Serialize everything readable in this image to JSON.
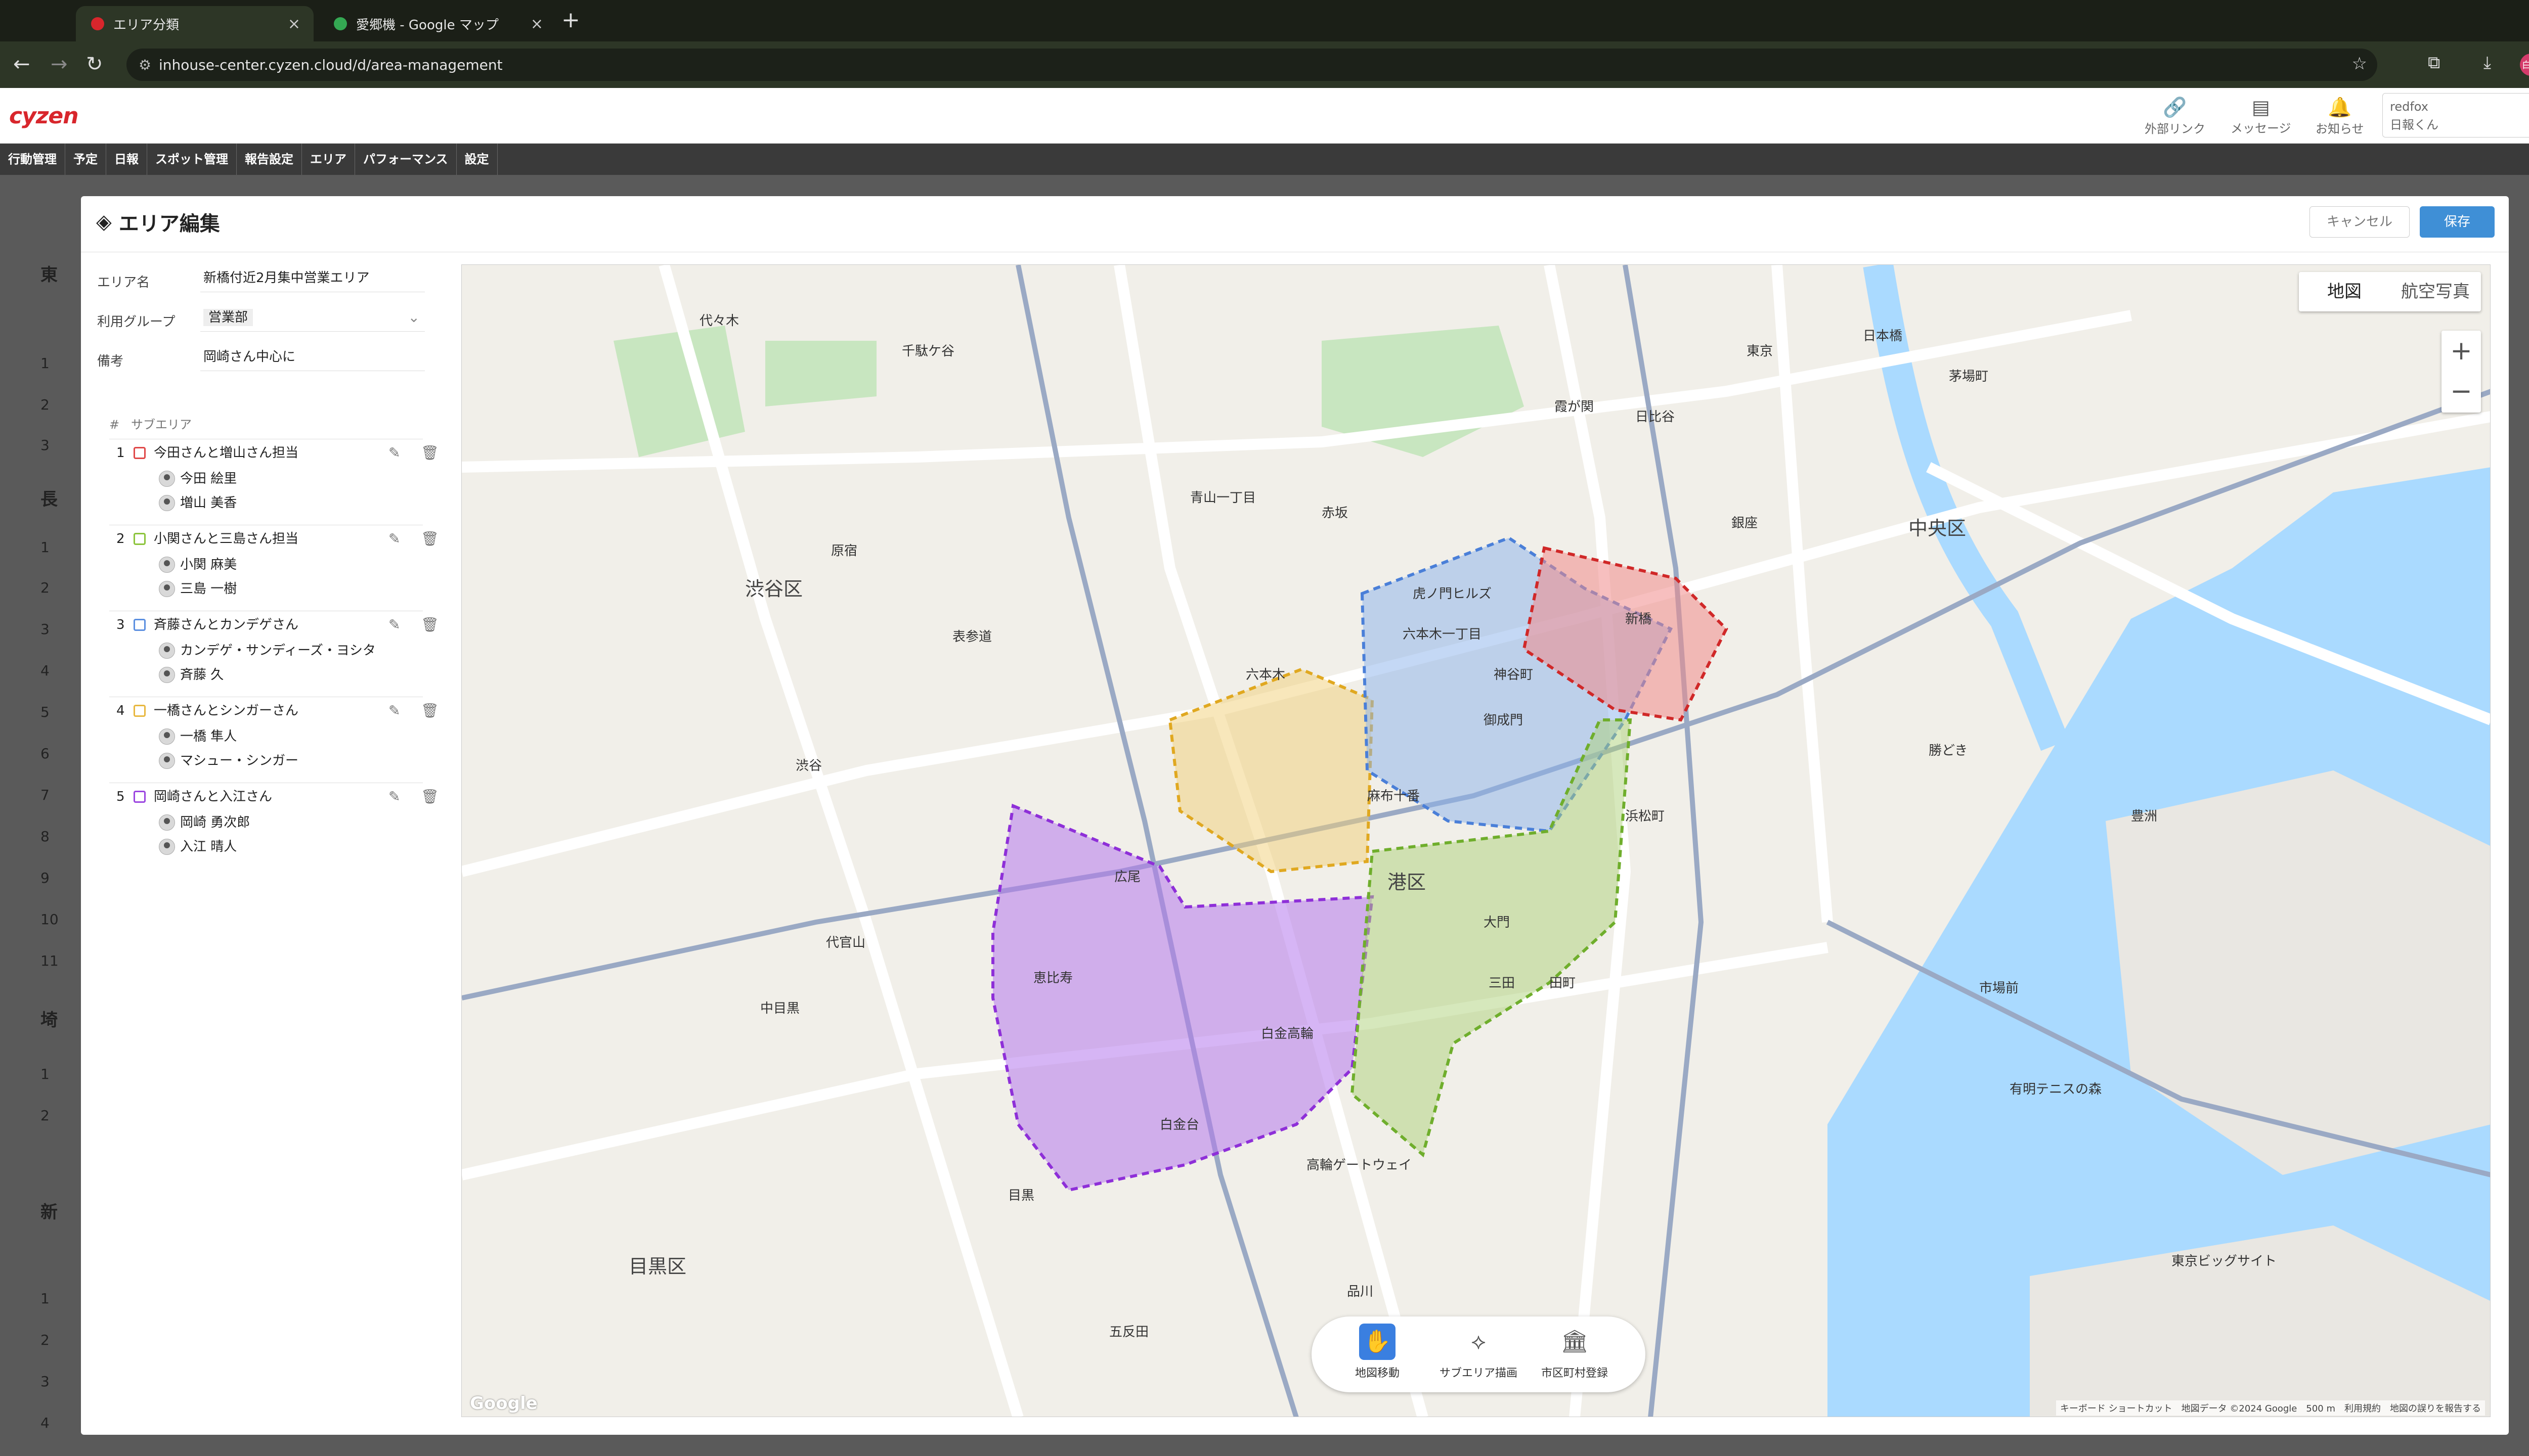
{
  "browser": {
    "tabs": [
      {
        "title": "エリア分類",
        "active": true
      },
      {
        "title": "愛郷機 - Google マップ",
        "active": false
      }
    ],
    "url": "inhouse-center.cyzen.cloud/d/area-management",
    "profile_initial": "白石"
  },
  "app": {
    "logo": "cyzen",
    "header_icons": [
      {
        "icon": "link-icon",
        "label": "外部リンク"
      },
      {
        "icon": "message-icon",
        "label": "メッセージ"
      },
      {
        "icon": "bell-icon",
        "label": "お知らせ"
      }
    ],
    "user": {
      "company": "redfox",
      "name": "日報くん"
    },
    "menu": [
      "行動管理",
      "予定",
      "日報",
      "スポット管理",
      "報告設定",
      "エリア",
      "パフォーマンス",
      "設定"
    ]
  },
  "background_page": {
    "sections": [
      "東",
      "長",
      "埼",
      "新"
    ],
    "row_numbers_1": [
      "1",
      "2",
      "3"
    ],
    "row_numbers_2": [
      "1",
      "2",
      "3",
      "4",
      "5",
      "6",
      "7",
      "8",
      "9",
      "10",
      "11"
    ],
    "row_numbers_3": [
      "1",
      "2"
    ],
    "row_numbers_4": [
      "1",
      "2",
      "3",
      "4"
    ]
  },
  "modal": {
    "title": "エリア編集",
    "cancel_label": "キャンセル",
    "save_label": "保存",
    "fields": {
      "area_name_label": "エリア名",
      "area_name_value": "新橋付近2月集中営業エリア",
      "group_label": "利用グループ",
      "group_value": "営業部",
      "note_label": "備考",
      "note_value": "岡崎さん中心に"
    },
    "subarea_header": {
      "num": "#",
      "label": "サブエリア"
    },
    "subareas": [
      {
        "num": "1",
        "name": "今田さんと増山さん担当",
        "color": "#e04848",
        "members": [
          "今田 絵里",
          "増山 美香"
        ]
      },
      {
        "num": "2",
        "name": "小関さんと三島さん担当",
        "color": "#8cc43c",
        "members": [
          "小関 麻美",
          "三島 一樹"
        ]
      },
      {
        "num": "3",
        "name": "斉藤さんとカンデゲさん",
        "color": "#5b8fe0",
        "members": [
          "カンデゲ・サンディーズ・ヨシタ",
          "斉藤 久"
        ]
      },
      {
        "num": "4",
        "name": "一橋さんとシンガーさん",
        "color": "#e8b840",
        "members": [
          "一橋 隼人",
          "マシュー・シンガー"
        ]
      },
      {
        "num": "5",
        "name": "岡崎さんと入江さん",
        "color": "#9b45e0",
        "members": [
          "岡崎 勇次郎",
          "入江 晴人"
        ]
      }
    ]
  },
  "map": {
    "type_map": "地図",
    "type_satellite": "航空写真",
    "zoom_in": "+",
    "zoom_out": "−",
    "tools": [
      {
        "icon": "hand-icon",
        "label": "地図移動",
        "active": true
      },
      {
        "icon": "polygon-draw-icon",
        "label": "サブエリア描画",
        "active": false
      },
      {
        "icon": "city-hall-icon",
        "label": "市区町村登録",
        "active": false
      }
    ],
    "attribution": "キーボード ショートカット　地図データ ©2024 Google　500 m　利用規約　地図の誤りを報告する",
    "google": "Google",
    "labels": {
      "shibuya": "渋谷区",
      "minato": "港区",
      "chuo": "中央区",
      "meguro": "目黒区",
      "toranomon": "虎ノ門ヒルズ",
      "roppongi1": "六本木一丁目",
      "shimbashi": "新橋",
      "kamiyacho": "神谷町",
      "onarimon": "御成門",
      "azabujuban": "麻布十番",
      "hiroo": "広尾",
      "ebisu": "恵比寿",
      "shirokanetakanawa": "白金高輪",
      "shirokanedai": "白金台",
      "shinagawa": "品川",
      "roppongi": "六本木",
      "tamachi": "田町",
      "mita": "三田",
      "daimon": "大門",
      "hamamatsucho": "浜松町",
      "shibuya_st": "渋谷",
      "omotesando": "表参道",
      "akasaka": "赤坂",
      "ginza": "銀座",
      "tokyo": "東京",
      "harajuku": "原宿",
      "meguro_st": "目黒",
      "gotanda": "五反田",
      "takanawa_gw": "高輪ゲートウェイ",
      "toyosu": "豊洲",
      "kachidoki": "勝どき",
      "ariake": "有明テニスの森",
      "shijomae": "市場前",
      "big_sight": "東京ビッグサイト",
      "nakameguro": "中目黒",
      "daikanyama": "代官山",
      "hibiya": "日比谷",
      "aoyama": "青山一丁目",
      "sendagaya": "千駄ケ谷",
      "yoyogi": "代々木",
      "kasumigaseki": "霞が関",
      "nihonbashi": "日本橋",
      "kayabacho": "茅場町",
      "ebisu_st": "恵比寿"
    }
  }
}
